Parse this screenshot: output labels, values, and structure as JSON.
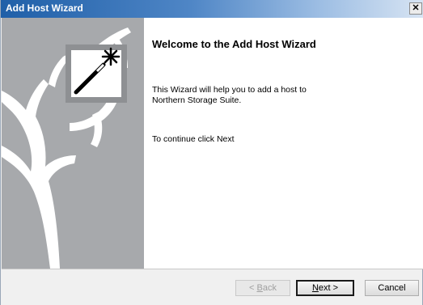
{
  "window": {
    "title": "Add Host Wizard",
    "close_glyph": "✕"
  },
  "content": {
    "heading": "Welcome to the Add Host Wizard",
    "intro_line1": "This Wizard will help you to add a host to",
    "intro_line2": "Northern Storage Suite.",
    "continue_text": "To continue click Next"
  },
  "buttons": {
    "back": {
      "mnemonic": "B",
      "rest": "ack",
      "prefix": "< "
    },
    "next": {
      "mnemonic": "N",
      "rest": "ext >"
    },
    "cancel": "Cancel"
  },
  "side_panel": {
    "graphic": "deer-antler-logo",
    "icon": "magic-wand-icon"
  },
  "colors": {
    "titlebar_start": "#1f5fa8",
    "side_panel": "#a7a9ac",
    "content_bg": "#ffffff"
  }
}
